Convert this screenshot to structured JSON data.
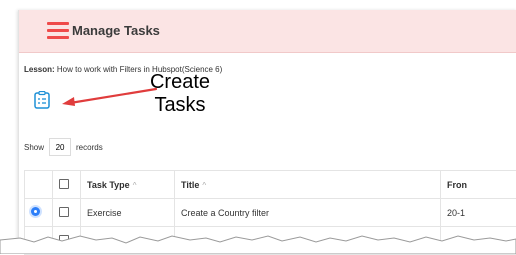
{
  "header": {
    "title": "Manage Tasks",
    "accent": "#ef4a4a",
    "background": "#fbe4e4"
  },
  "lesson": {
    "label": "Lesson:",
    "value": "How to work with Filters in Hubspot(Science 6)"
  },
  "annotation": {
    "line1": "Create",
    "line2": "Tasks",
    "arrow_color": "#e03c3c"
  },
  "pagination": {
    "show_label": "Show",
    "count": "20",
    "records_label": "records"
  },
  "table": {
    "columns": [
      "Task Type",
      "Title",
      "Fron"
    ],
    "sort_glyph": "^",
    "rows": [
      {
        "type": "Exercise",
        "title": "Create a Country filter",
        "from": "20-1"
      }
    ]
  },
  "icons": {
    "menu": "hamburger-icon",
    "create": "task-list-icon",
    "selected": "radio-selected-icon"
  }
}
